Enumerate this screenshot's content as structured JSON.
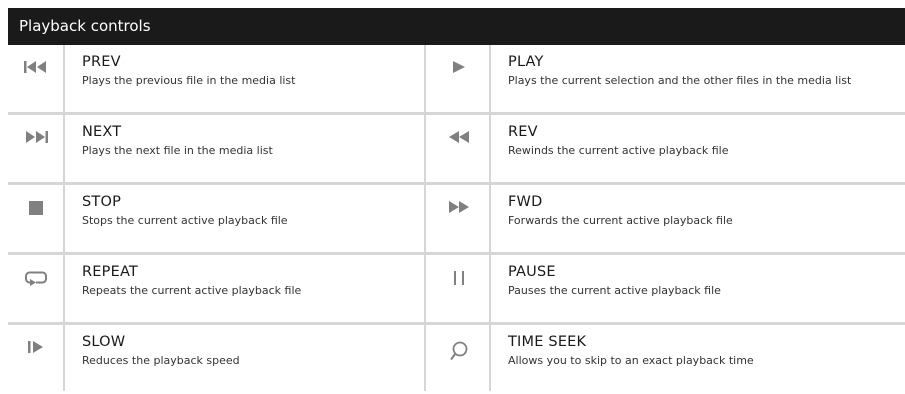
{
  "header": {
    "title": "Playback controls"
  },
  "colors": {
    "header_bg": "#1a1a1a",
    "icon": "#808080",
    "divider": "#d6d6d6"
  },
  "rows": [
    {
      "left": {
        "icon": "prev-icon",
        "title": "PREV",
        "desc": "Plays the previous file in the media list"
      },
      "right": {
        "icon": "play-icon",
        "title": "PLAY",
        "desc": "Plays the current selection and the other files in the media list"
      }
    },
    {
      "left": {
        "icon": "next-icon",
        "title": "NEXT",
        "desc": "Plays the next file in the media list"
      },
      "right": {
        "icon": "rewind-icon",
        "title": "REV",
        "desc": "Rewinds the current active playback file"
      }
    },
    {
      "left": {
        "icon": "stop-icon",
        "title": "STOP",
        "desc": "Stops the current active playback file"
      },
      "right": {
        "icon": "fast-forward-icon",
        "title": "FWD",
        "desc": "Forwards the current active playback file"
      }
    },
    {
      "left": {
        "icon": "repeat-icon",
        "title": "REPEAT",
        "desc": "Repeats the current active playback file"
      },
      "right": {
        "icon": "pause-icon",
        "title": "PAUSE",
        "desc": "Pauses the current active playback file"
      }
    },
    {
      "left": {
        "icon": "slow-icon",
        "title": "SLOW",
        "desc": "Reduces the playback speed"
      },
      "right": {
        "icon": "time-seek-icon",
        "title": "TIME SEEK",
        "desc": "Allows you to skip to an exact playback time"
      }
    }
  ]
}
